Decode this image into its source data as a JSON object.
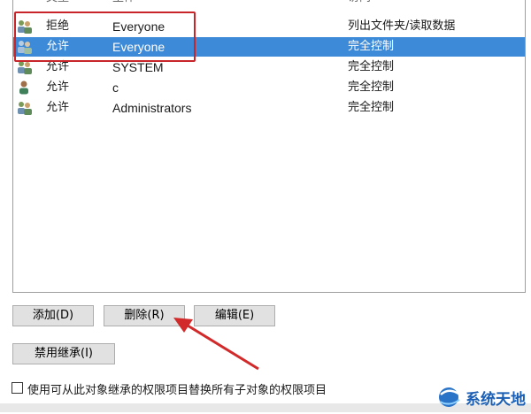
{
  "list": {
    "header": {
      "type": "类型",
      "principal": "主体",
      "access": "访问"
    },
    "rows": [
      {
        "type": "拒绝",
        "principal": "Everyone",
        "access": "列出文件夹/读取数据",
        "icon": "group-icon"
      },
      {
        "type": "允许",
        "principal": "Everyone",
        "access": "完全控制",
        "icon": "group-icon",
        "selected": true
      },
      {
        "type": "允许",
        "principal": "SYSTEM",
        "access": "完全控制",
        "icon": "group-icon"
      },
      {
        "type": "允许",
        "principal": "c",
        "access": "完全控制",
        "icon": "user-icon"
      },
      {
        "type": "允许",
        "principal": "Administrators",
        "access": "完全控制",
        "icon": "group-icon"
      }
    ]
  },
  "buttons": {
    "add": "添加(D)",
    "remove": "删除(R)",
    "edit": "编辑(E)",
    "disable_inheritance": "禁用继承(I)"
  },
  "replace_checkbox": {
    "label": "使用可从此对象继承的权限项目替换所有子对象的权限项目",
    "checked": false
  },
  "watermark": {
    "text": "系统天地"
  },
  "colors": {
    "selection": "#3c8ad8",
    "highlight": "#c8252b",
    "brand": "#1b5fb4"
  }
}
